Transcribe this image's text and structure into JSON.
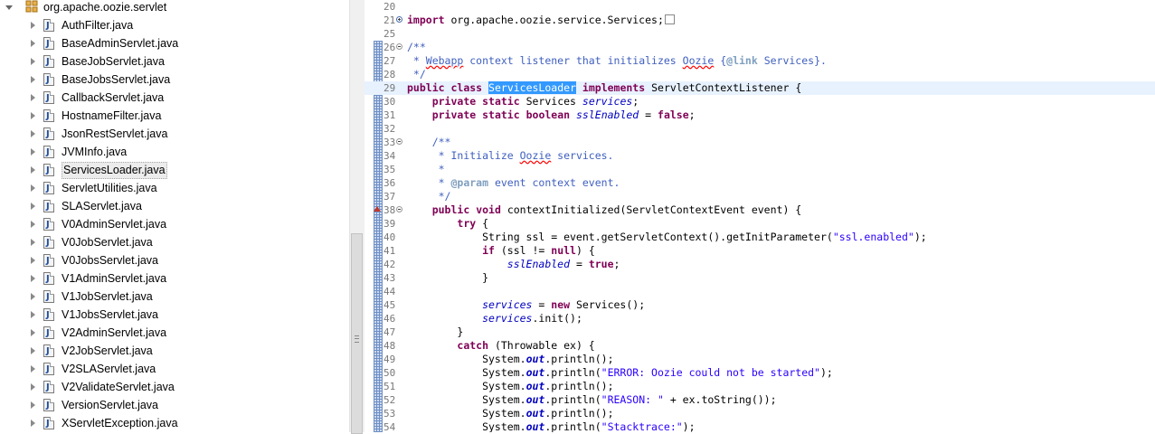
{
  "explorer": {
    "package": "org.apache.oozie.servlet",
    "selected": "ServicesLoader.java",
    "files": [
      "AuthFilter.java",
      "BaseAdminServlet.java",
      "BaseJobServlet.java",
      "BaseJobsServlet.java",
      "CallbackServlet.java",
      "HostnameFilter.java",
      "JsonRestServlet.java",
      "JVMInfo.java",
      "ServicesLoader.java",
      "ServletUtilities.java",
      "SLAServlet.java",
      "V0AdminServlet.java",
      "V0JobServlet.java",
      "V0JobsServlet.java",
      "V1AdminServlet.java",
      "V1JobServlet.java",
      "V1JobsServlet.java",
      "V2AdminServlet.java",
      "V2JobServlet.java",
      "V2SLAServlet.java",
      "V2ValidateServlet.java",
      "VersionServlet.java",
      "XServletException.java"
    ],
    "file_icon_letter": "J"
  },
  "editor": {
    "lines": [
      {
        "n": "20",
        "fold": "",
        "code": ""
      },
      {
        "n": "21",
        "fold": "plus",
        "code": "import org.apache.oozie.service.Services;"
      },
      {
        "n": "25",
        "fold": "",
        "code": ""
      },
      {
        "n": "26",
        "fold": "minus",
        "code": "/**"
      },
      {
        "n": "27",
        "fold": "",
        "code": " * Webapp context listener that initializes Oozie {@link Services}."
      },
      {
        "n": "28",
        "fold": "",
        "code": " */"
      },
      {
        "n": "29",
        "fold": "",
        "code": "public class ServicesLoader implements ServletContextListener {"
      },
      {
        "n": "30",
        "fold": "",
        "code": "    private static Services services;"
      },
      {
        "n": "31",
        "fold": "",
        "code": "    private static boolean sslEnabled = false;"
      },
      {
        "n": "32",
        "fold": "",
        "code": ""
      },
      {
        "n": "33",
        "fold": "minus",
        "code": "    /**"
      },
      {
        "n": "34",
        "fold": "",
        "code": "     * Initialize Oozie services."
      },
      {
        "n": "35",
        "fold": "",
        "code": "     *"
      },
      {
        "n": "36",
        "fold": "",
        "code": "     * @param event context event."
      },
      {
        "n": "37",
        "fold": "",
        "code": "     */"
      },
      {
        "n": "38",
        "fold": "minus",
        "code": "    public void contextInitialized(ServletContextEvent event) {"
      },
      {
        "n": "39",
        "fold": "",
        "code": "        try {"
      },
      {
        "n": "40",
        "fold": "",
        "code": "            String ssl = event.getServletContext().getInitParameter(\"ssl.enabled\");"
      },
      {
        "n": "41",
        "fold": "",
        "code": "            if (ssl != null) {"
      },
      {
        "n": "42",
        "fold": "",
        "code": "                sslEnabled = true;"
      },
      {
        "n": "43",
        "fold": "",
        "code": "            }"
      },
      {
        "n": "44",
        "fold": "",
        "code": ""
      },
      {
        "n": "45",
        "fold": "",
        "code": "            services = new Services();"
      },
      {
        "n": "46",
        "fold": "",
        "code": "            services.init();"
      },
      {
        "n": "47",
        "fold": "",
        "code": "        }"
      },
      {
        "n": "48",
        "fold": "",
        "code": "        catch (Throwable ex) {"
      },
      {
        "n": "49",
        "fold": "",
        "code": "            System.out.println();"
      },
      {
        "n": "50",
        "fold": "",
        "code": "            System.out.println(\"ERROR: Oozie could not be started\");"
      },
      {
        "n": "51",
        "fold": "",
        "code": "            System.out.println();"
      },
      {
        "n": "52",
        "fold": "",
        "code": "            System.out.println(\"REASON: \" + ex.toString());"
      },
      {
        "n": "53",
        "fold": "",
        "code": "            System.out.println();"
      },
      {
        "n": "54",
        "fold": "",
        "code": "            System.out.println(\"Stacktrace:\");"
      }
    ],
    "current_line": "29",
    "selected_word": "ServicesLoader"
  },
  "colors": {
    "keyword": "#7f0055",
    "comment": "#3f5fbf",
    "string": "#2a00ff",
    "field": "#0000c0",
    "current_line": "#e8f2fe",
    "selection": "#3399ff"
  },
  "icons": {
    "package": "package-icon",
    "java_file": "java-file-icon",
    "expand": "expand-arrow-icon",
    "fold_plus": "fold-expand-icon",
    "fold_minus": "fold-collapse-icon",
    "override": "override-marker-icon"
  }
}
